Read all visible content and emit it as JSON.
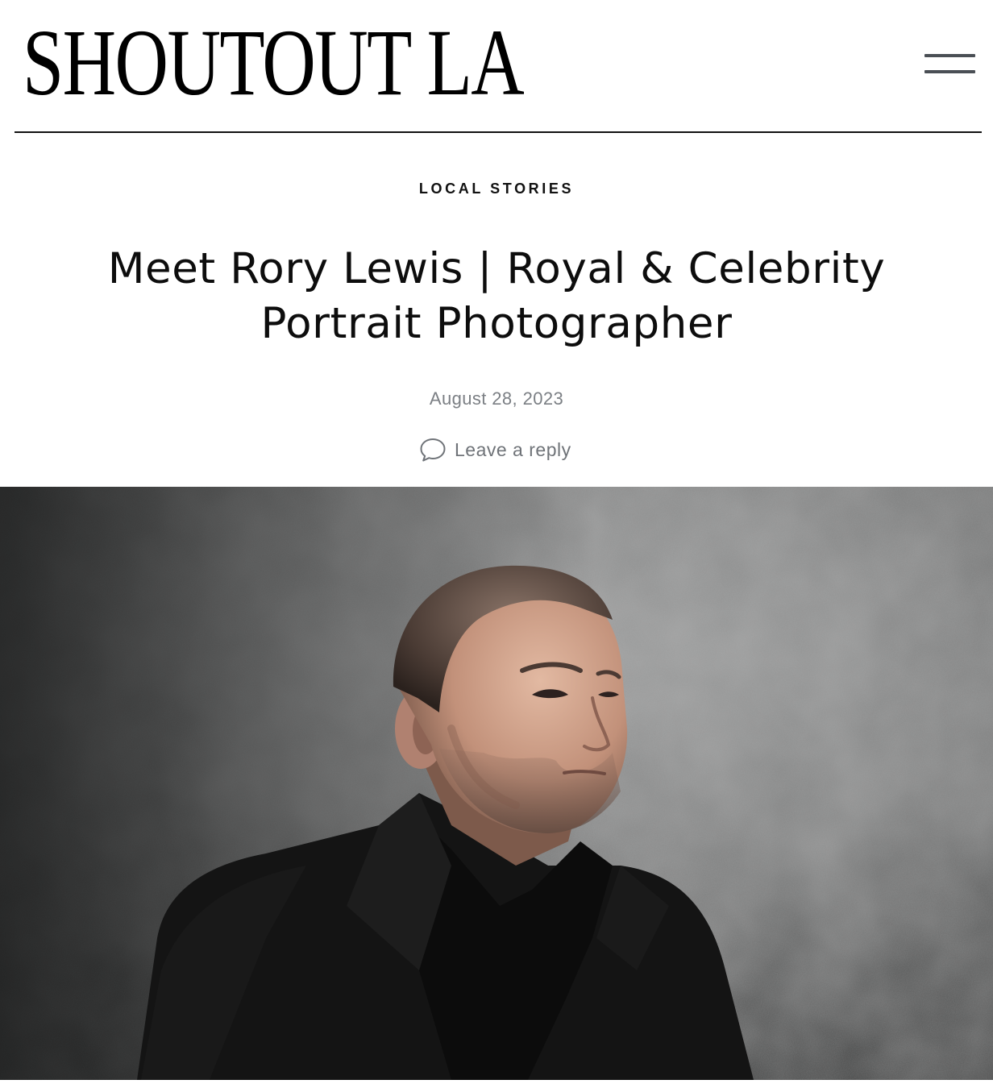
{
  "header": {
    "logo_text": "SHOUTOUT LA",
    "menu_icon": "hamburger-menu-icon"
  },
  "article": {
    "category": "LOCAL STORIES",
    "title": "Meet Rory Lewis | Royal & Celebrity Portrait Photographer",
    "date": "August 28, 2023",
    "reply_label": "Leave a reply",
    "reply_icon": "speech-bubble-icon"
  },
  "hero_image": {
    "subject": "portrait-photo",
    "colors": {
      "background": "#7a7b7b",
      "suit": "#141414",
      "skin": "#c9a08a"
    }
  },
  "colors": {
    "text": "#111111",
    "muted": "#7b7f84",
    "menu_bar": "#4a4f55",
    "rule": "#111111"
  }
}
